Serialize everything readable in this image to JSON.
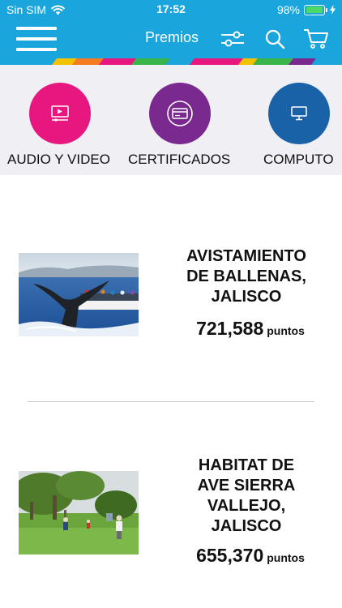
{
  "status_bar": {
    "carrier": "Sin SIM",
    "time": "17:52",
    "battery": "98%",
    "battery_level": 0.98
  },
  "nav": {
    "title": "Premios",
    "icons": [
      "menu-icon",
      "filter-icon",
      "search-icon",
      "cart-icon"
    ]
  },
  "categories": [
    {
      "label": "AUDIO Y VIDEO",
      "icon": "video-icon",
      "color": "#e8177f"
    },
    {
      "label": "CERTIFICADOS",
      "icon": "card-icon",
      "color": "#7a2a8e"
    },
    {
      "label": "COMPUTO",
      "icon": "monitor-icon",
      "color": "#1a62a8"
    }
  ],
  "products": [
    {
      "title_lines": [
        "AVISTAMIENTO",
        "DE BALLENAS,",
        "JALISCO"
      ],
      "points": "721,588",
      "points_unit": "puntos",
      "image": "whale-tail-photo"
    },
    {
      "title_lines": [
        "HABITAT DE",
        "AVE SIERRA",
        "VALLEJO,",
        "JALISCO"
      ],
      "points": "655,370",
      "points_unit": "puntos",
      "image": "park-photo"
    }
  ],
  "colors": {
    "header": "#1aa5dd",
    "category_bg": "#efeff4",
    "divider": "#c8c8cc"
  }
}
